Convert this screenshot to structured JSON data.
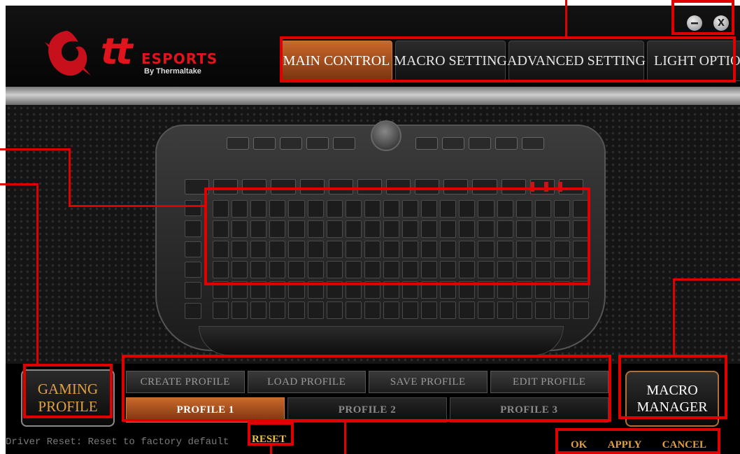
{
  "header": {
    "brand": {
      "logo": "tt",
      "brand_name": "ESPORTS",
      "by": "By Thermaltake"
    },
    "window_controls": {
      "minimize_icon": "minimize-icon",
      "close_icon": "close-icon",
      "close_glyph": "X"
    },
    "tabs": [
      {
        "label": "MAIN CONTROL",
        "active": true
      },
      {
        "label": "MACRO SETTING",
        "active": false
      },
      {
        "label": "ADVANCED SETTING",
        "active": false
      },
      {
        "label": "LIGHT OPTION",
        "active": false
      }
    ]
  },
  "profile": {
    "gaming_profile_label": "GAMING PROFILE",
    "gaming_profile_line1": "GAMING",
    "gaming_profile_line2": "PROFILE",
    "actions": [
      "CREATE PROFILE",
      "LOAD PROFILE",
      "SAVE PROFILE",
      "EDIT PROFILE"
    ],
    "profiles": [
      {
        "label": "PROFILE 1",
        "active": true
      },
      {
        "label": "PROFILE 2",
        "active": false
      },
      {
        "label": "PROFILE 3",
        "active": false
      }
    ],
    "macro_manager_line1": "MACRO",
    "macro_manager_line2": "MANAGER"
  },
  "footer": {
    "reset_description": "Driver Reset: Reset to factory default",
    "reset_label": "RESET",
    "ok_label": "OK",
    "apply_label": "APPLY",
    "cancel_label": "CANCEL"
  },
  "colors": {
    "accent_orange": "#c9682b",
    "brand_red": "#e0141c",
    "annotation_red": "#e10000",
    "label_gold": "#e0a040"
  }
}
